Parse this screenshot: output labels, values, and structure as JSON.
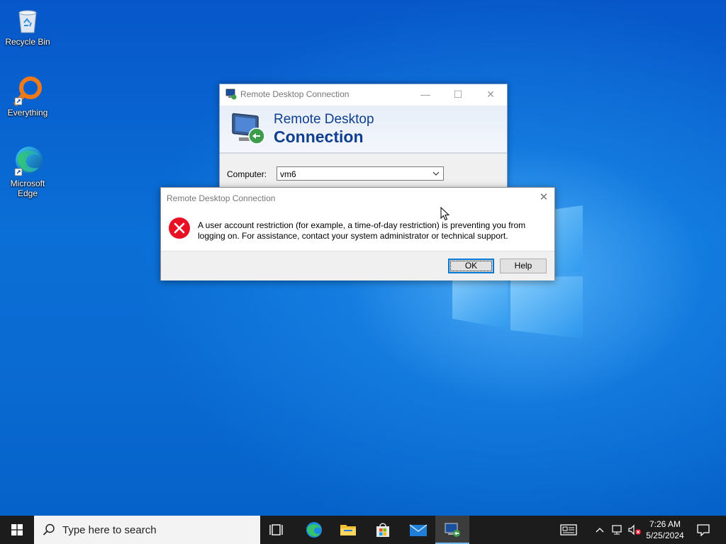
{
  "desktop": {
    "icons": [
      {
        "label": "Recycle Bin",
        "icon": "recycle-bin-icon"
      },
      {
        "label": "Everything",
        "icon": "everything-search-icon"
      },
      {
        "label": "Microsoft Edge",
        "icon": "edge-icon"
      }
    ]
  },
  "rdc_window": {
    "title": "Remote Desktop Connection",
    "banner_line1": "Remote Desktop",
    "banner_line2": "Connection",
    "computer_label": "Computer:",
    "computer_value": "vm6"
  },
  "error_dialog": {
    "title": "Remote Desktop Connection",
    "message": "A user account restriction (for example, a time-of-day restriction) is preventing you from logging on. For assistance, contact your system administrator or technical support.",
    "ok_label": "OK",
    "help_label": "Help"
  },
  "taskbar": {
    "search_placeholder": "Type here to search",
    "apps": [
      "task-view-icon",
      "edge-icon",
      "file-explorer-icon",
      "microsoft-store-icon",
      "mail-icon",
      "remote-desktop-icon"
    ],
    "time": "7:26 AM",
    "date": "5/25/2024"
  },
  "colors": {
    "desktop_blue": "#0a72d4",
    "taskbar": "#1c1c1c",
    "error_red": "#e81123",
    "banner_text": "#0f3f8e",
    "focus_blue": "#0078d7"
  }
}
